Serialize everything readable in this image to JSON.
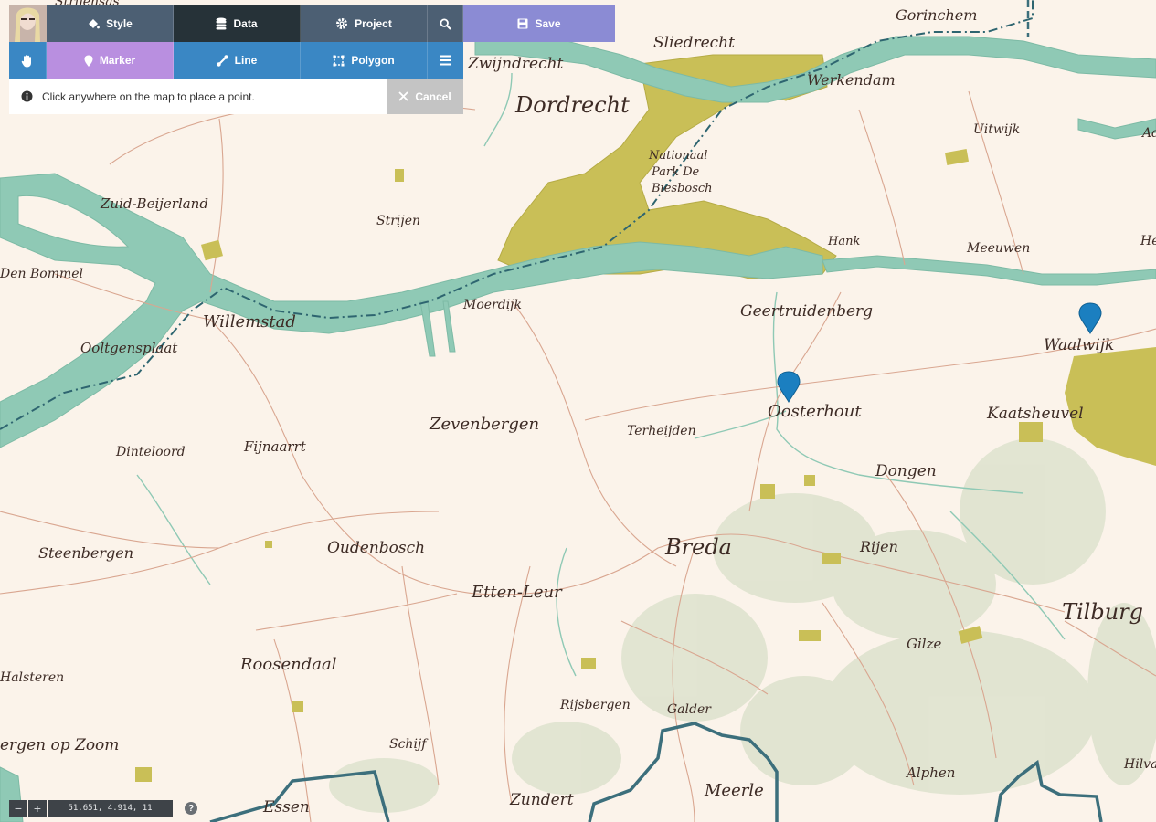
{
  "toolbar": {
    "style_label": "Style",
    "data_label": "Data",
    "project_label": "Project",
    "save_label": "Save",
    "marker_label": "Marker",
    "line_label": "Line",
    "polygon_label": "Polygon"
  },
  "hint": {
    "text": "Click anywhere on the map to place a point.",
    "cancel_label": "Cancel"
  },
  "status": {
    "coordinates": "51.651, 4.914, 11",
    "zoom_out": "−",
    "zoom_in": "+",
    "help": "?"
  },
  "colors": {
    "land": "#fbf3ea",
    "water": "#8fc9b5",
    "park": "#c7be52",
    "border": "#3c6f7c",
    "accent_save": "#8b8bd4",
    "accent_marker": "#b98fe0",
    "accent_draw": "#3a87c4",
    "toolbar_dark": "#263238",
    "toolbar_slate": "#4c5f73",
    "pin": "#1b7fc0"
  },
  "map": {
    "places": {
      "gorinchem": "Gorinchem",
      "sliedrecht": "Sliedrecht",
      "zwijndrecht": "Zwijndrecht",
      "werkendam": "Werkendam",
      "dordrecht": "Dordrecht",
      "uitwijk": "Uitwijk",
      "park1": "Nationaal",
      "park2": "Park De",
      "park3": "Biesbosch",
      "zuid_beijerland": "Zuid-Beijerland",
      "strijen": "Strijen",
      "hank": "Hank",
      "meeuwen": "Meeuwen",
      "den_bommel": "Den Bommel",
      "moerdijk": "Moerdijk",
      "geertruidenberg": "Geertruidenberg",
      "willemstad": "Willemstad",
      "ooltgensplaat": "Ooltgensplaat",
      "waalwijk": "Waalwijk",
      "oosterhout": "Oosterhout",
      "kaatsheuvel": "Kaatsheuvel",
      "zevenbergen": "Zevenbergen",
      "terheijden": "Terheijden",
      "dinteloord": "Dinteloord",
      "fijnaart": "Fijnaarrt",
      "dongen": "Dongen",
      "steenbergen": "Steenbergen",
      "oudenbosch": "Oudenbosch",
      "breda": "Breda",
      "rijen": "Rijen",
      "etten_leur": "Etten-Leur",
      "tilburg": "Tilburg",
      "gilze": "Gilze",
      "roosendaal": "Roosendaal",
      "halsteren": "Halsteren",
      "rijsbergen": "Rijsbergen",
      "galder": "Galder",
      "bergen_op_zoom": "ergen op Zoom",
      "schijf": "Schijf",
      "meerle": "Meerle",
      "alphen": "Alphen",
      "hilva": "Hilva",
      "zundert": "Zundert",
      "essen": "Essen",
      "ad": "Ad",
      "he": "He",
      "top_left": "Strijensas"
    }
  }
}
